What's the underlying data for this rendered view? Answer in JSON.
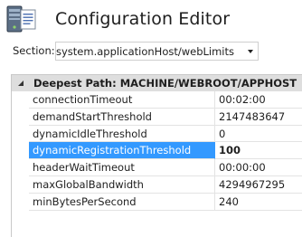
{
  "app": {
    "title": "Configuration Editor",
    "icon": "configuration-editor-icon"
  },
  "section": {
    "label": "Section:",
    "value": "system.applicationHost/webLimits"
  },
  "grid": {
    "header": "Deepest Path: MACHINE/WEBROOT/APPHOST",
    "rows": [
      {
        "name": "connectionTimeout",
        "value": "00:02:00"
      },
      {
        "name": "demandStartThreshold",
        "value": "2147483647"
      },
      {
        "name": "dynamicIdleThreshold",
        "value": "0"
      },
      {
        "name": "dynamicRegistrationThreshold",
        "value": "100"
      },
      {
        "name": "headerWaitTimeout",
        "value": "00:00:00"
      },
      {
        "name": "maxGlobalBandwidth",
        "value": "4294967295"
      },
      {
        "name": "minBytesPerSecond",
        "value": "240"
      }
    ],
    "selected_row": 3,
    "selection_color": "#3399ff"
  }
}
